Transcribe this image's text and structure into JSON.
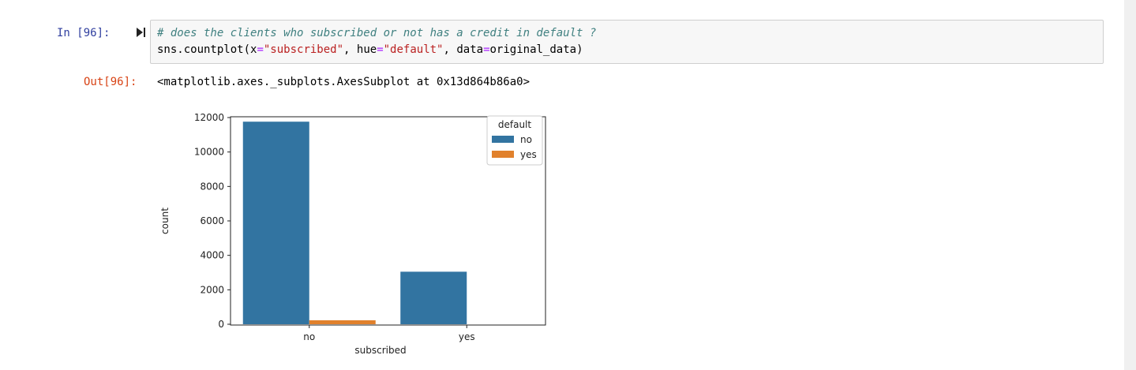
{
  "cell": {
    "in_prompt": "In [96]:",
    "out_prompt": "Out[96]:",
    "code_comment": "# does the clients who subscribed or not has a credit in default ?",
    "code_tokens": [
      "sns.countplot(x",
      "=",
      "\"subscribed\"",
      ", hue",
      "=",
      "\"default\"",
      ", data",
      "=",
      "original_data)"
    ],
    "output_text": "<matplotlib.axes._subplots.AxesSubplot at 0x13d864b86a0>"
  },
  "icons": {
    "run": "run-cell-icon"
  },
  "colors": {
    "no": "#3274a1",
    "yes": "#e1812c",
    "in_prompt": "#303f9f",
    "out_prompt": "#d84315"
  },
  "chart_data": {
    "type": "bar",
    "categories": [
      "no",
      "yes"
    ],
    "series": [
      {
        "name": "no",
        "values": [
          11760,
          3050
        ]
      },
      {
        "name": "yes",
        "values": [
          230,
          0
        ]
      }
    ],
    "xlabel": "subscribed",
    "ylabel": "count",
    "ylim": [
      0,
      12000
    ],
    "yticks": [
      "0",
      "2000",
      "4000",
      "6000",
      "8000",
      "10000",
      "12000"
    ],
    "legend": {
      "title": "default",
      "entries": [
        "no",
        "yes"
      ],
      "placement": "top-right"
    },
    "grid": false
  }
}
